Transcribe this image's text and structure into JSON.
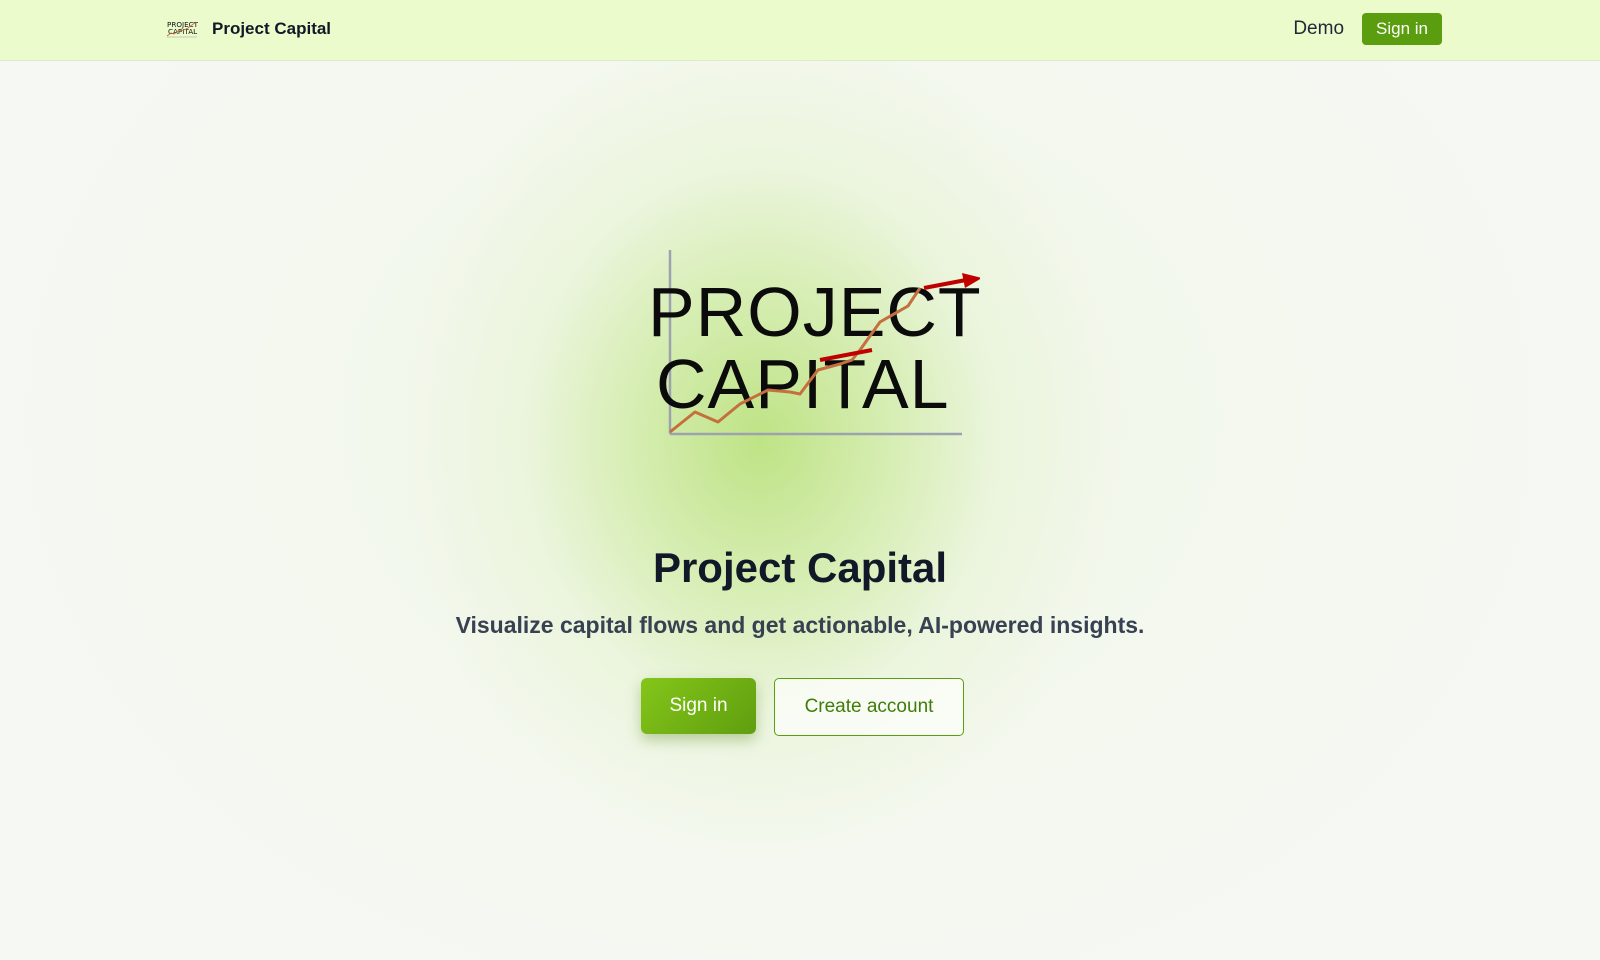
{
  "nav": {
    "brand_logo_text": "PROJECT CAPITAL",
    "brand_name": "Project Capital",
    "demo_label": "Demo",
    "signin_label": "Sign in"
  },
  "hero": {
    "logo_line1": "PROJECT",
    "logo_line2": "CAPITAL",
    "title": "Project Capital",
    "subtitle": "Visualize capital flows and get actionable, AI-powered insights.",
    "primary_button": "Sign in",
    "secondary_button": "Create account"
  },
  "colors": {
    "accent": "#5a9e0f",
    "topbar_bg": "#ecfbcb",
    "logo_line": "#c06a3a",
    "logo_arrow": "#c00000"
  },
  "icons": {
    "brand": "project-capital-logo-icon",
    "hero": "project-capital-logo"
  }
}
